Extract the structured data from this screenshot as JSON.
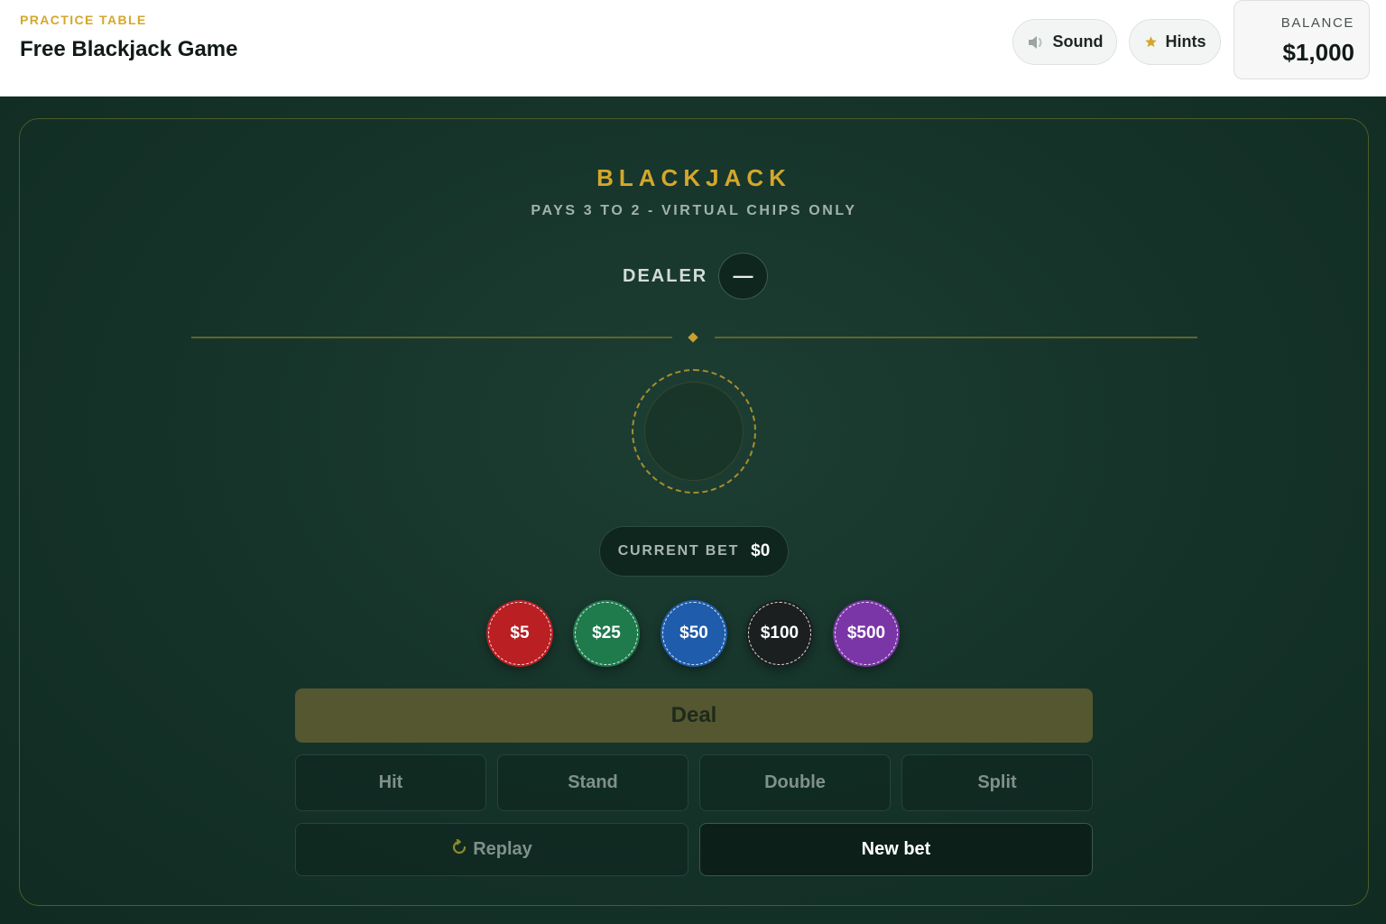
{
  "header": {
    "eyebrow": "PRACTICE TABLE",
    "title": "Free Blackjack Game",
    "sound_label": "Sound",
    "sound_icon": "speaker-icon",
    "hints_label": "Hints",
    "hints_icon": "star-icon",
    "balance_label": "BALANCE",
    "balance_value": "$1,000"
  },
  "table": {
    "title": "BLACKJACK",
    "subtitle": "PAYS 3 TO 2 - VIRTUAL CHIPS ONLY",
    "dealer_label": "DEALER",
    "dealer_score": "—",
    "current_bet_label": "CURRENT BET",
    "current_bet_value": "$0"
  },
  "chips": [
    {
      "label": "$5",
      "color": "#b91f23"
    },
    {
      "label": "$25",
      "color": "#1f7a4c"
    },
    {
      "label": "$50",
      "color": "#1f5cab"
    },
    {
      "label": "$100",
      "color": "#1b1f20"
    },
    {
      "label": "$500",
      "color": "#7a35a6"
    }
  ],
  "actions": {
    "deal": "Deal",
    "hit": "Hit",
    "stand": "Stand",
    "double": "Double",
    "split": "Split",
    "replay": "Replay",
    "replay_icon": "replay-icon",
    "new_bet": "New bet"
  },
  "colors": {
    "accent_gold": "#d4a72c",
    "felt_green": "#16342a"
  }
}
